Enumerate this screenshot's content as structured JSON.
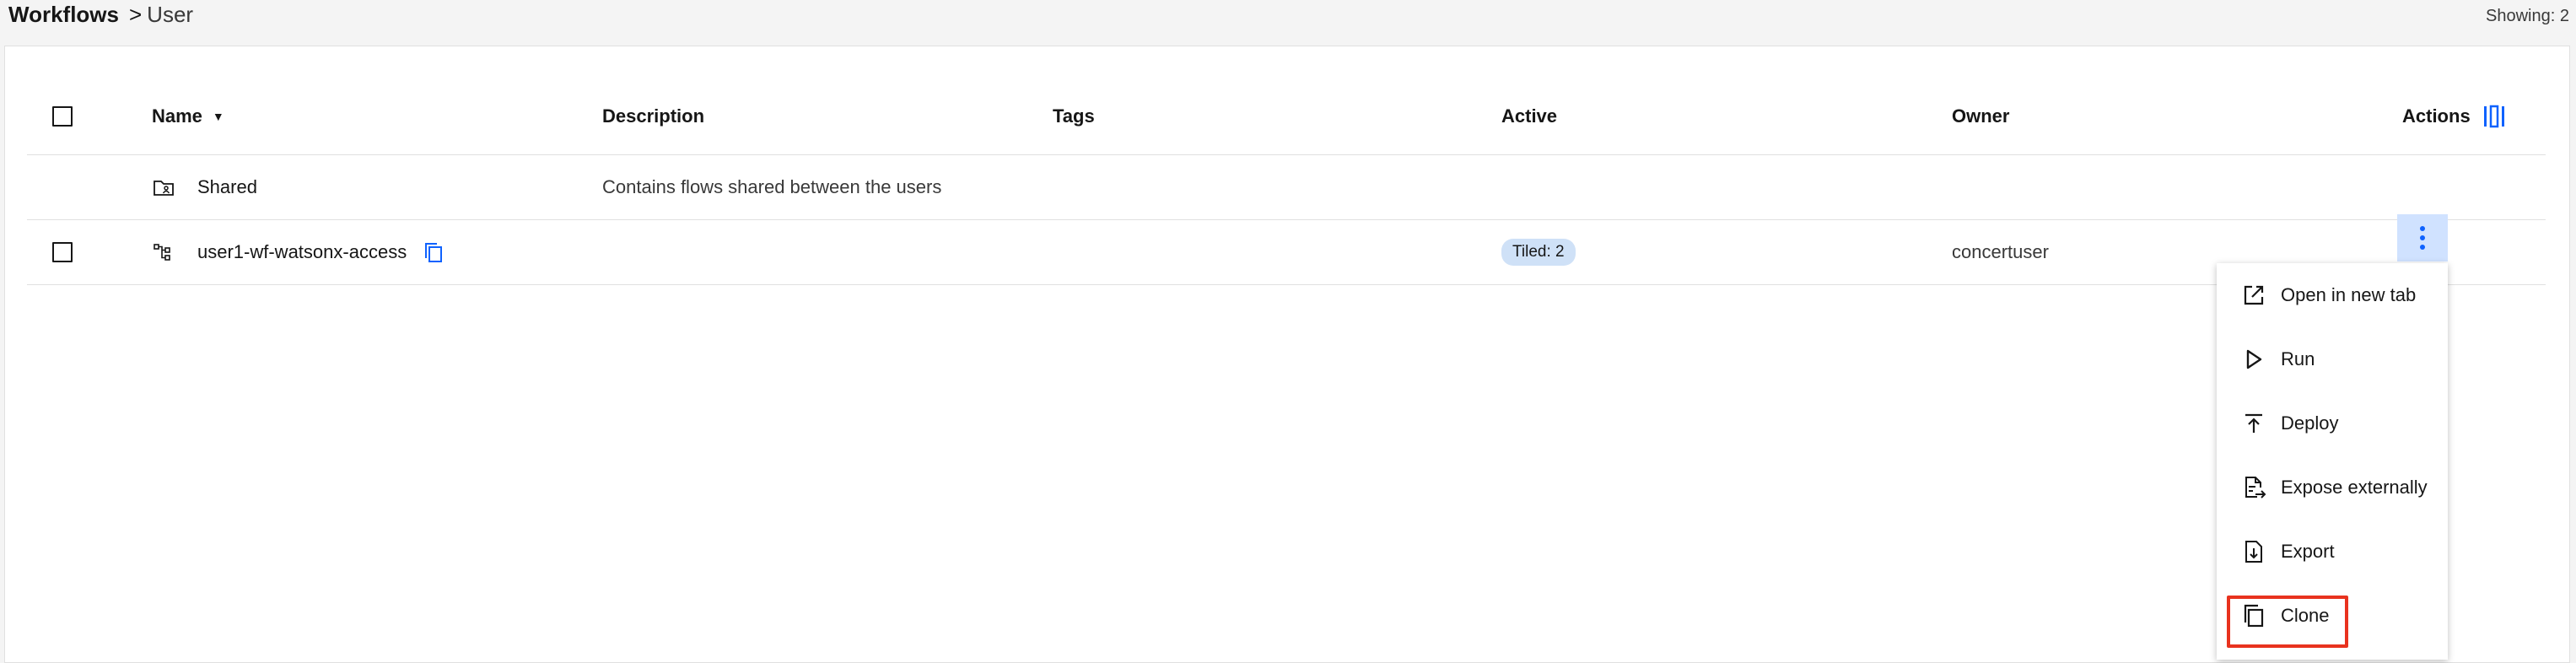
{
  "breadcrumb": {
    "root": "Workflows",
    "separator": ">",
    "current": "User"
  },
  "showing": "Showing: 2",
  "table": {
    "columns": [
      "Name",
      "Description",
      "Tags",
      "Active",
      "Owner",
      "Actions"
    ],
    "rows": [
      {
        "type": "folder",
        "name": "Shared",
        "description": "Contains flows shared between the users",
        "active": "",
        "owner": ""
      },
      {
        "type": "workflow",
        "name": "user1-wf-watsonx-access",
        "description": "",
        "active": "Tiled: 2",
        "owner": "concertuser"
      }
    ]
  },
  "menu": {
    "items": [
      {
        "label": "Open in new tab",
        "icon": "launch-icon"
      },
      {
        "label": "Run",
        "icon": "play-icon"
      },
      {
        "label": "Deploy",
        "icon": "deploy-icon"
      },
      {
        "label": "Expose externally",
        "icon": "expose-icon"
      },
      {
        "label": "Export",
        "icon": "export-icon"
      },
      {
        "label": "Clone",
        "icon": "copy-icon"
      }
    ],
    "highlighted": "Clone"
  },
  "colors": {
    "accent": "#0f62fe",
    "highlight": "#e8321e",
    "tag_bg": "#cfe1f7",
    "kebab_bg": "#d0e2ff"
  }
}
